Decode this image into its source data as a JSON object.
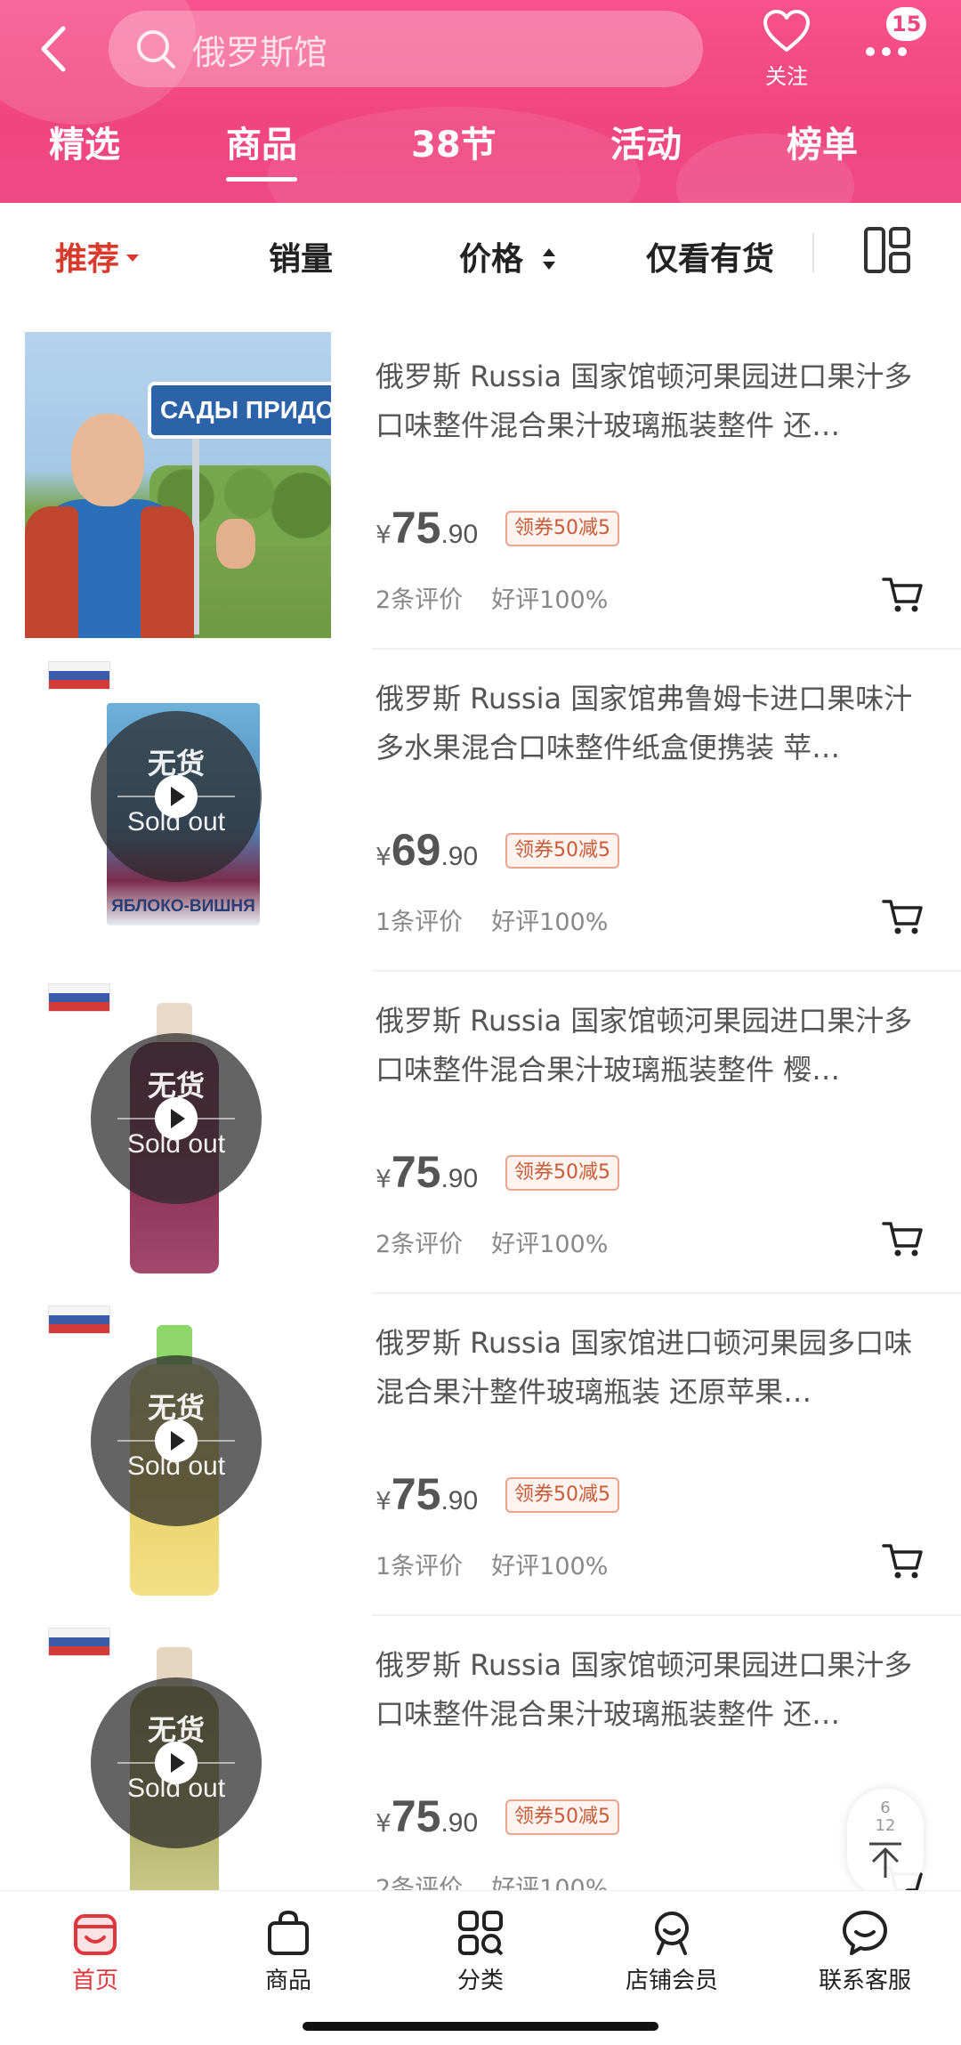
{
  "header": {
    "search_placeholder": "俄罗斯馆",
    "follow_label": "关注",
    "message_count": "15",
    "tabs": [
      {
        "label": "精选",
        "active": false
      },
      {
        "label": "商品",
        "active": true
      },
      {
        "label": "38节",
        "active": false
      },
      {
        "label": "活动",
        "active": false
      },
      {
        "label": "榜单",
        "active": false
      }
    ]
  },
  "filters": {
    "recommend": "推荐",
    "sales": "销量",
    "price": "价格",
    "in_stock": "仅看有货"
  },
  "products": [
    {
      "title": "俄罗斯 Russia 国家馆顿河果园进口果汁多口味整件混合果汁玻璃瓶装整件 还…",
      "price_currency": "¥",
      "price_int": "75",
      "price_dec": ".90",
      "coupon": "领券50减5",
      "review_count": "2条评价",
      "good_rate": "好评100%",
      "image_sign_text": "САДЫ ПРИДО",
      "sold_out": false
    },
    {
      "title": "俄罗斯 Russia 国家馆弗鲁姆卡进口果味汁多水果混合口味整件纸盒便携装 苹…",
      "price_currency": "¥",
      "price_int": "69",
      "price_dec": ".90",
      "coupon": "领券50减5",
      "review_count": "1条评价",
      "good_rate": "好评100%",
      "package_text": "ЯБЛОКО-ВИШНЯ",
      "sold_out": true,
      "sold_out_cn": "无货",
      "sold_out_en": "Sold out"
    },
    {
      "title": "俄罗斯 Russia 国家馆顿河果园进口果汁多口味整件混合果汁玻璃瓶装整件 樱…",
      "price_currency": "¥",
      "price_int": "75",
      "price_dec": ".90",
      "coupon": "领券50减5",
      "review_count": "2条评价",
      "good_rate": "好评100%",
      "sold_out": true,
      "sold_out_cn": "无货",
      "sold_out_en": "Sold out"
    },
    {
      "title": "俄罗斯 Russia 国家馆进口顿河果园多口味混合果汁整件玻璃瓶装 还原苹果…",
      "price_currency": "¥",
      "price_int": "75",
      "price_dec": ".90",
      "coupon": "领券50减5",
      "review_count": "1条评价",
      "good_rate": "好评100%",
      "sold_out": true,
      "sold_out_cn": "无货",
      "sold_out_en": "Sold out"
    },
    {
      "title": "俄罗斯 Russia 国家馆顿河果园进口果汁多口味整件混合果汁玻璃瓶装整件 还…",
      "price_currency": "¥",
      "price_int": "75",
      "price_dec": ".90",
      "coupon": "领券50减5",
      "review_count": "2条评价",
      "good_rate": "好评100%",
      "sold_out": true,
      "sold_out_cn": "无货",
      "sold_out_en": "Sold out"
    }
  ],
  "back_to_top": {
    "page_current": "6",
    "page_total": "12"
  },
  "bottom_nav": [
    {
      "label": "首页",
      "icon": "shop-home-icon",
      "active": true
    },
    {
      "label": "商品",
      "icon": "shopping-bag-icon",
      "active": false
    },
    {
      "label": "分类",
      "icon": "category-grid-icon",
      "active": false
    },
    {
      "label": "店铺会员",
      "icon": "member-icon",
      "active": false
    },
    {
      "label": "联系客服",
      "icon": "chat-service-icon",
      "active": false
    }
  ],
  "colors": {
    "header_pink": "#f0467f",
    "active_red": "#d83a2c",
    "coupon_border": "#e9a38f"
  }
}
